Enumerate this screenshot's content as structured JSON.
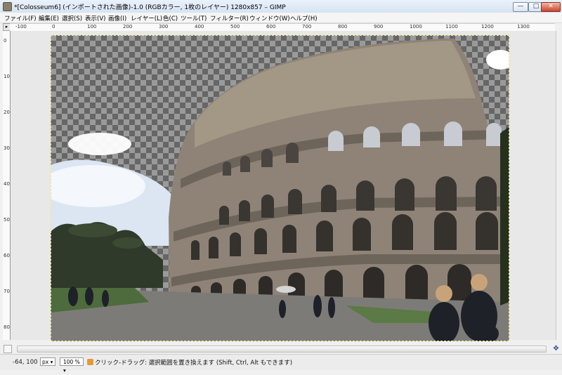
{
  "window": {
    "title": "*[Colosseum6] (インポートされた画像)-1.0 (RGBカラー, 1枚のレイヤー) 1280x857 – GIMP",
    "minimize": "—",
    "maximize": "□",
    "close": "✕"
  },
  "menu": [
    "ファイル(F)",
    "編集(E)",
    "選択(S)",
    "表示(V)",
    "画像(I)",
    "レイヤー(L)",
    "色(C)",
    "ツール(T)",
    "フィルター(R)",
    "ウィンドウ(W)",
    "ヘルプ(H)"
  ],
  "ruler": {
    "h_labels": [
      "-100",
      "0",
      "100",
      "200",
      "300",
      "400",
      "500",
      "600",
      "700",
      "800",
      "900",
      "1000",
      "1100",
      "1200",
      "1300"
    ],
    "v_labels": [
      "0",
      "100",
      "200",
      "300",
      "400",
      "500",
      "600",
      "700",
      "800"
    ]
  },
  "status": {
    "coords": "-64, 100",
    "unit": "px",
    "zoom": "100 %",
    "message": "クリック-ドラッグ: 選択範囲を置き換えます (Shift, Ctrl, Alt もできます)"
  },
  "icons": {
    "app": "gimp-icon",
    "navigate": "navigate-icon",
    "status": "select-tool-icon"
  }
}
